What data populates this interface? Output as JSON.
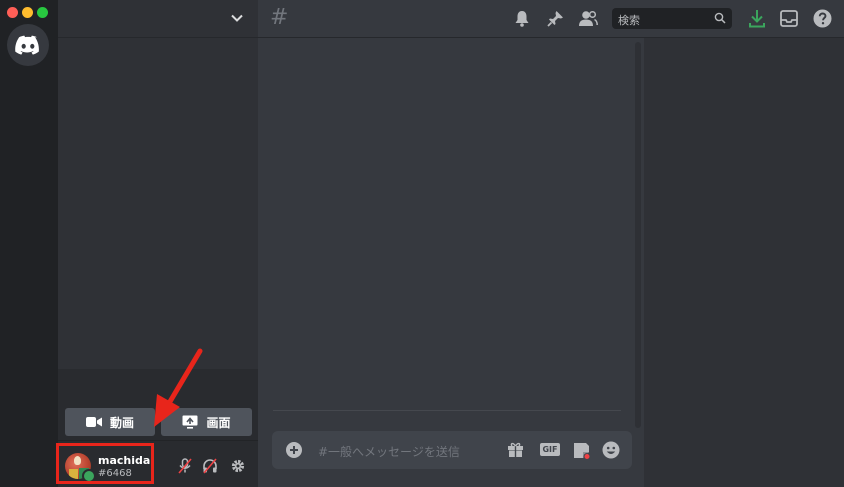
{
  "window": {
    "traffic_colors": [
      "#ff5f57",
      "#febc2e",
      "#28c840"
    ]
  },
  "server_rail": {
    "home_icon": "discord-logo-icon"
  },
  "sidebar": {
    "media_panel": {
      "video_label": "動画",
      "screen_label": "画面"
    },
    "user": {
      "name": "machida",
      "discriminator": "#6468",
      "status_color": "#3ba55d"
    }
  },
  "header": {
    "channel_icon": "#",
    "search_placeholder": "検索",
    "icons": [
      "bell-icon",
      "pin-icon",
      "members-icon",
      "search-icon",
      "download-icon",
      "inbox-icon",
      "help-icon"
    ]
  },
  "composer": {
    "placeholder": "#一般へメッセージを送信",
    "gif_label": "GIF",
    "icons": [
      "add-icon",
      "gift-icon",
      "gif-icon",
      "sticker-icon",
      "emoji-icon"
    ]
  },
  "annotation": {
    "color": "#e8251b"
  }
}
